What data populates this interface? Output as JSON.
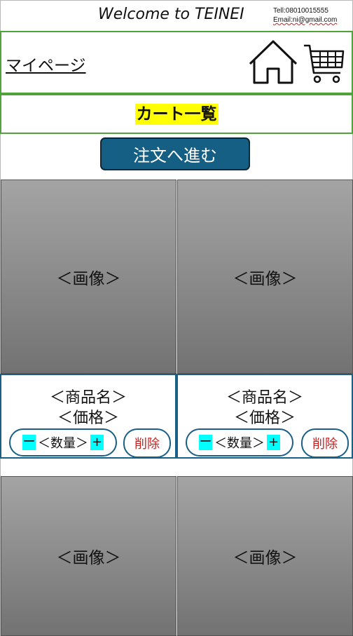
{
  "header": {
    "welcome": "Welcome to TEINEI",
    "tel": "Tell:08010015555",
    "email": "Email:ni@gmail.com"
  },
  "nav": {
    "mypage": "マイページ",
    "home_icon": "home-icon",
    "cart_icon": "cart-icon"
  },
  "cart": {
    "title": "カート一覧",
    "order_button": "注文へ進む"
  },
  "products": [
    {
      "image": "＜画像＞",
      "name": "＜商品名＞",
      "price": "＜価格＞",
      "minus": "ー",
      "qty": "＜数量＞",
      "plus": "+",
      "delete": "削除"
    },
    {
      "image": "＜画像＞",
      "name": "＜商品名＞",
      "price": "＜価格＞",
      "minus": "ー",
      "qty": "＜数量＞",
      "plus": "+",
      "delete": "削除"
    },
    {
      "image": "＜画像＞"
    },
    {
      "image": "＜画像＞"
    }
  ],
  "colors": {
    "accent_green": "#4ea33a",
    "button_blue": "#155e84",
    "highlight_yellow": "#ffff00",
    "qty_cyan": "#00ffff",
    "delete_red": "#d81b1b"
  }
}
